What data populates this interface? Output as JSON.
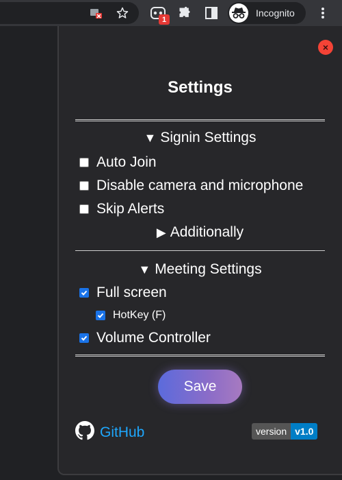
{
  "browser": {
    "incognito_label": "Incognito",
    "extension_badge_count": "1"
  },
  "popup": {
    "title": "Settings",
    "close_glyph": "×",
    "signin": {
      "heading": "Signin Settings",
      "heading_marker": "▼",
      "options": [
        {
          "label": "Auto Join",
          "checked": false
        },
        {
          "label": "Disable camera and microphone",
          "checked": false
        },
        {
          "label": "Skip Alerts",
          "checked": false
        }
      ],
      "additionally": {
        "label": "Additionally",
        "marker": "▶"
      }
    },
    "meeting": {
      "heading": "Meeting Settings",
      "heading_marker": "▼",
      "options": [
        {
          "label": "Full screen",
          "checked": true
        },
        {
          "label": "HotKey (F)",
          "checked": true
        },
        {
          "label": "Volume Controller",
          "checked": true
        }
      ]
    },
    "save_label": "Save",
    "github_label": "GitHub",
    "version": {
      "key": "version",
      "value": "v1.0"
    }
  },
  "colors": {
    "accent_link": "#1ea7fd",
    "checkbox_checked": "#1a73e8",
    "close_button": "#f44336",
    "version_value_bg": "#007ec6"
  },
  "icons": {
    "toolbar": [
      "camera-blocked-icon",
      "star-icon",
      "extension-badge-icon",
      "puzzle-icon",
      "side-panel-icon",
      "incognito-icon",
      "kebab-menu-icon"
    ],
    "popup": [
      "close-icon",
      "github-icon"
    ]
  }
}
